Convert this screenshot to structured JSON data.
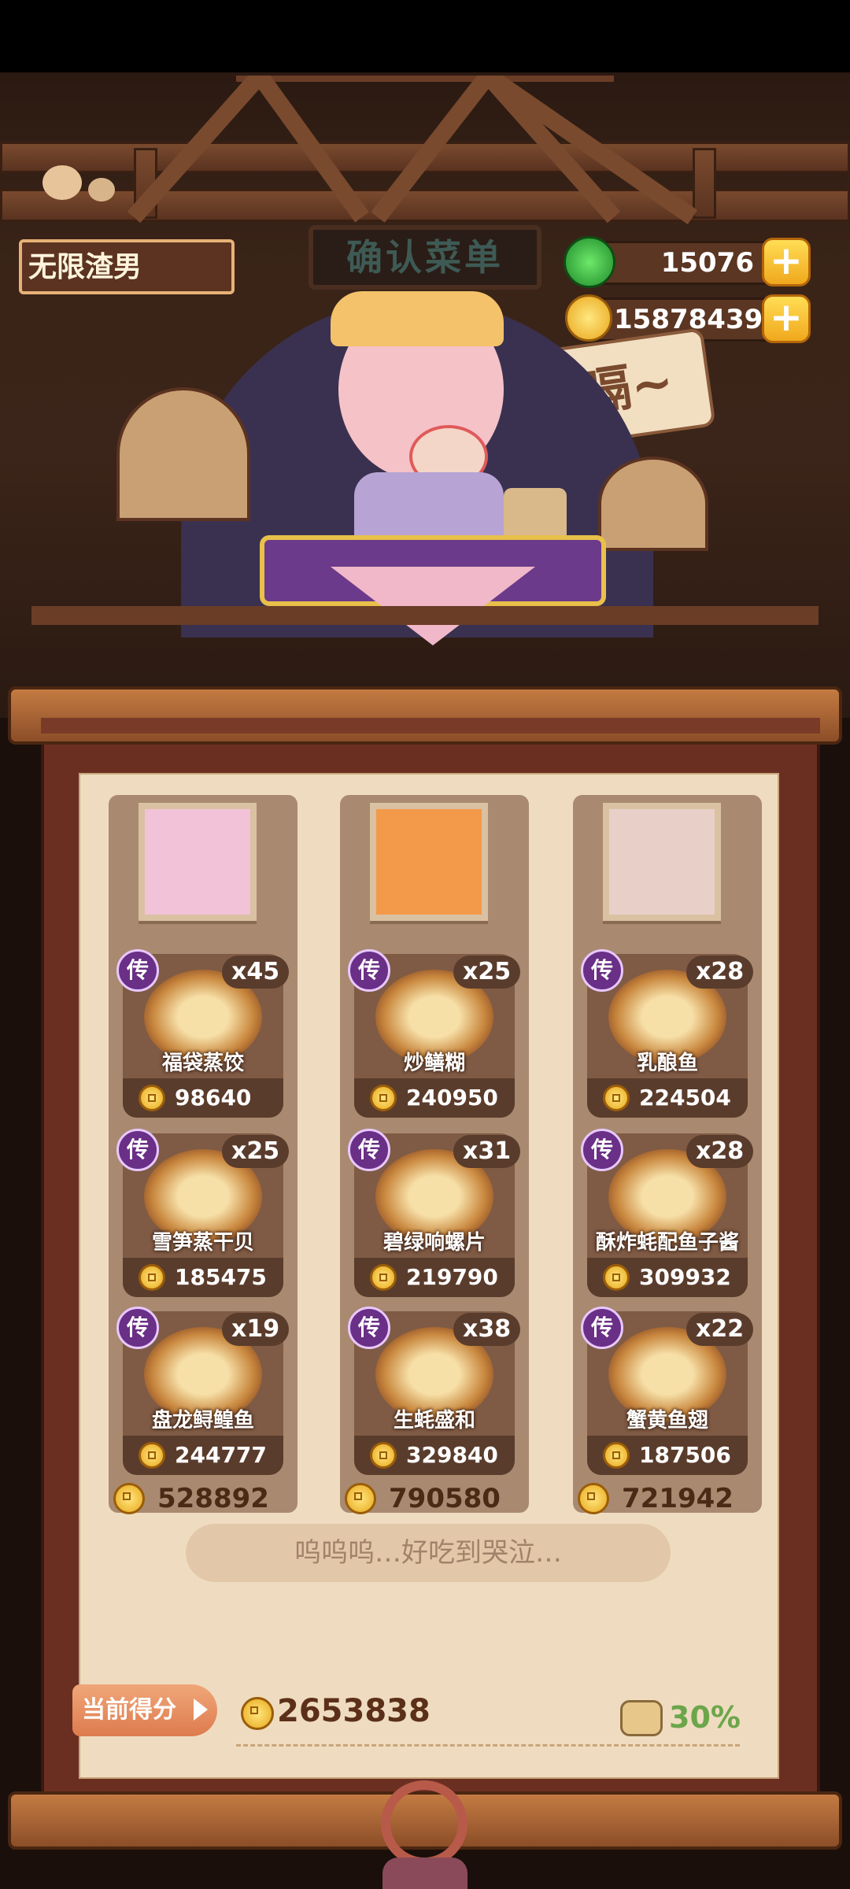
{
  "player": {
    "name": "无限渣男"
  },
  "sign": {
    "title": "确认菜单"
  },
  "resources": {
    "jade": {
      "icon": "jade-icon",
      "value": "15076"
    },
    "coins": {
      "icon": "coin-icon",
      "value": "15878439"
    }
  },
  "speech": {
    "text": "嗝~"
  },
  "columns": [
    {
      "portrait": "character-portrait-1",
      "dishes": [
        {
          "badge": "传",
          "qty": "x45",
          "name": "福袋蒸饺",
          "price": "98640"
        },
        {
          "badge": "传",
          "qty": "x25",
          "name": "雪笋蒸干贝",
          "price": "185475"
        },
        {
          "badge": "传",
          "qty": "x19",
          "name": "盘龙鲟鳇鱼",
          "price": "244777"
        }
      ],
      "total": "528892"
    },
    {
      "portrait": "character-portrait-2",
      "dishes": [
        {
          "badge": "传",
          "qty": "x25",
          "name": "炒鳝糊",
          "price": "240950"
        },
        {
          "badge": "传",
          "qty": "x31",
          "name": "碧绿响螺片",
          "price": "219790"
        },
        {
          "badge": "传",
          "qty": "x38",
          "name": "生蚝盛和",
          "price": "329840"
        }
      ],
      "total": "790580"
    },
    {
      "portrait": "character-portrait-3",
      "dishes": [
        {
          "badge": "传",
          "qty": "x28",
          "name": "乳酿鱼",
          "price": "224504"
        },
        {
          "badge": "传",
          "qty": "x28",
          "name": "酥炸蚝配鱼子酱",
          "price": "309932"
        },
        {
          "badge": "传",
          "qty": "x22",
          "name": "蟹黄鱼翅",
          "price": "187506"
        }
      ],
      "total": "721942"
    }
  ],
  "comment": "呜呜呜…好吃到哭泣…",
  "score": {
    "label": "当前得分",
    "value": "2653838",
    "percent": "30%"
  },
  "colors": {
    "scroll": "#6b2f22",
    "paper": "#efdcc0",
    "legend_badge": "#6a2f86",
    "accent_gold": "#f0a81d"
  }
}
